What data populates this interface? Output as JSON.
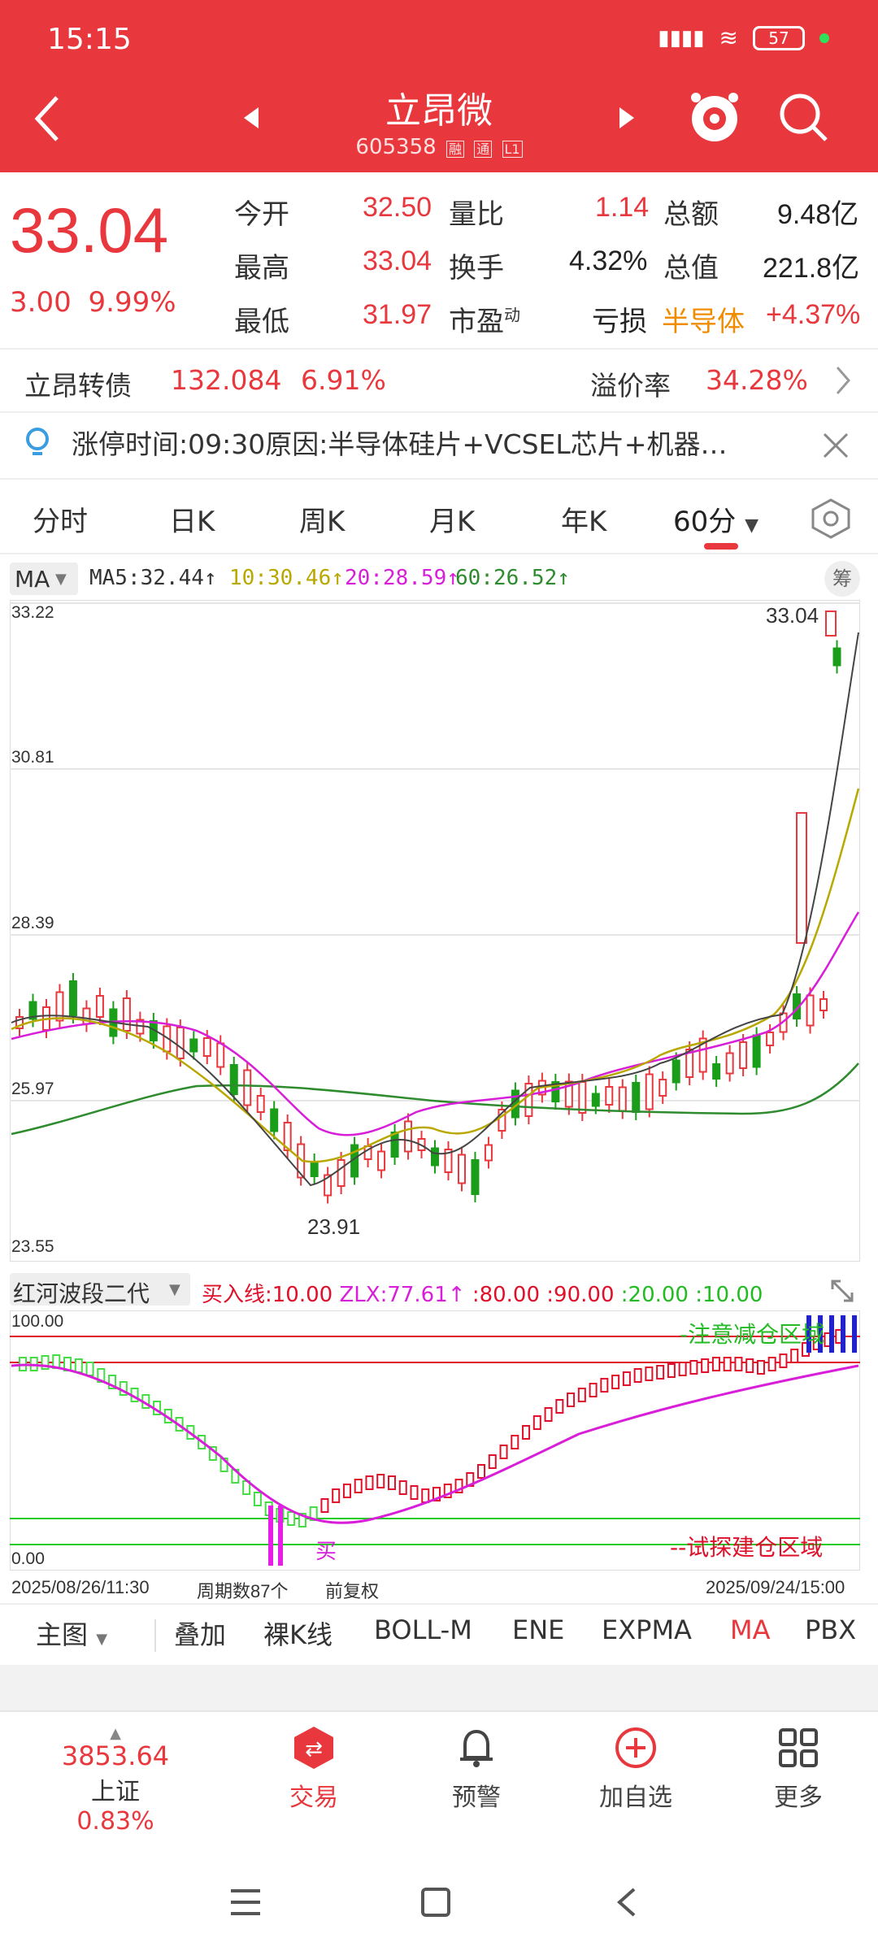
{
  "status_bar": {
    "time": "15:15",
    "battery": "57"
  },
  "header": {
    "title": "立昂微",
    "code": "605358",
    "tags": [
      "融",
      "通",
      "L1"
    ]
  },
  "quote": {
    "price": "33.04",
    "change": "3.00",
    "change_pct": "9.99%",
    "rows": [
      {
        "l1": "今开",
        "v1": "32.50",
        "l2": "量比",
        "v2": "1.14",
        "l3": "总额",
        "v3": "9.48亿"
      },
      {
        "l1": "最高",
        "v1": "33.04",
        "l2": "换手",
        "v2": "4.32%",
        "l3": "总值",
        "v3": "221.8亿"
      },
      {
        "l1": "最低",
        "v1": "31.97",
        "l2": "市盈",
        "l2sup": "动",
        "v2": "亏损",
        "l3": "半导体",
        "v3": "+4.37%"
      }
    ]
  },
  "bond": {
    "name": "立昂转债",
    "price": "132.084",
    "pct": "6.91%",
    "premium_label": "溢价率",
    "premium": "34.28%"
  },
  "notice": {
    "text": "涨停时间:09:30原因:半导体硅片+VCSEL芯片+机器…"
  },
  "tabs": [
    "分时",
    "日K",
    "周K",
    "月K",
    "年K",
    "60分"
  ],
  "ma_legend": {
    "selector": "MA",
    "ma5": "MA5:32.44↑",
    "ma10": "10:30.46↑",
    "ma20": "20:28.59↑",
    "ma60": "60:26.52↑",
    "side_btn": "筹",
    "colors": {
      "ma5": "#333333",
      "ma10": "#b8a800",
      "ma20": "#d81ed8",
      "ma60": "#2e8b2e"
    }
  },
  "main_chart": {
    "y_labels": [
      "33.22",
      "30.81",
      "28.39",
      "25.97",
      "23.55"
    ],
    "high_label": "33.04",
    "low_label": "23.91"
  },
  "sub_chart": {
    "selector": "红河波段二代",
    "legend": [
      {
        "text": "买入线:10.00",
        "color": "#e0102a"
      },
      {
        "text": "ZLX:77.61↑",
        "color": "#d81ed8"
      },
      {
        "text": ":80.00",
        "color": "#e0102a"
      },
      {
        "text": ":90.00",
        "color": "#e0102a"
      },
      {
        "text": ":20.00",
        "color": "#22bb22"
      },
      {
        "text": ":10.00",
        "color": "#22bb22"
      }
    ],
    "y_top": "100.00",
    "y_bottom": "0.00",
    "zone_top": "-注意减仓区域",
    "zone_bottom": "--试探建仓区域",
    "buy_mark": "买"
  },
  "time_axis": {
    "start": "2025/08/26/11:30",
    "count": "周期数87个",
    "adj": "前复权",
    "end": "2025/09/24/15:00"
  },
  "indicators": [
    "主图",
    "叠加",
    "裸K线",
    "BOLL-M",
    "ENE",
    "EXPMA",
    "MA",
    "PBX"
  ],
  "bottom_nav": [
    {
      "value": "3853.64",
      "label": "上证",
      "pct": "0.83%"
    },
    {
      "label": "交易"
    },
    {
      "label": "预警"
    },
    {
      "label": "加自选"
    },
    {
      "label": "更多"
    }
  ]
}
